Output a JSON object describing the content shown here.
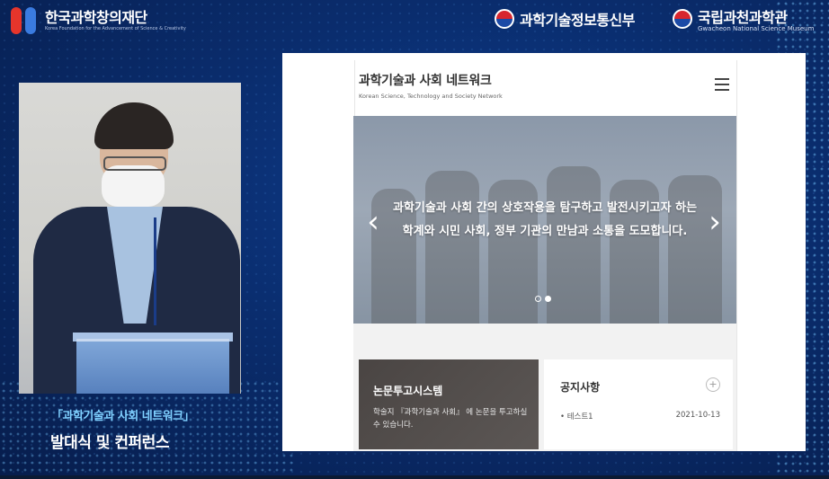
{
  "branding": {
    "foundation_name": "한국과학창의재단",
    "foundation_sub": "Korea Foundation for the Advancement of Science & Creativity",
    "ministry_name": "과학기술정보통신부",
    "museum_name": "국립과천과학관",
    "museum_sub": "Gwacheon National Science Museum"
  },
  "caption": {
    "line1": "「과학기술과 사회 네트워크」",
    "line2": "발대식 및 컨퍼런스"
  },
  "website": {
    "title": "과학기술과 사회 네트워크",
    "subtitle": "Korean Science, Technology and Society Network",
    "hero_line1": "과학기술과 사회 간의 상호작용을 탐구하고 발전시키고자 하는",
    "hero_line2": "학계와 시민 사회, 정부 기관의 만남과 소통을 도모합니다.",
    "submission_title": "논문투고시스템",
    "submission_desc": "학술지 『과학기술과 사회』 에 논문을 투고하실 수 있습니다.",
    "notice_title": "공지사항",
    "notice_items": [
      {
        "label": "• 테스트1",
        "date": "2021-10-13"
      }
    ],
    "carousel": {
      "slides": 2,
      "active": 2
    }
  },
  "colors": {
    "background": "#0a2d6e",
    "caption_accent": "#7fd0ff",
    "logo_red": "#e5352b",
    "logo_blue": "#3a7be0"
  }
}
